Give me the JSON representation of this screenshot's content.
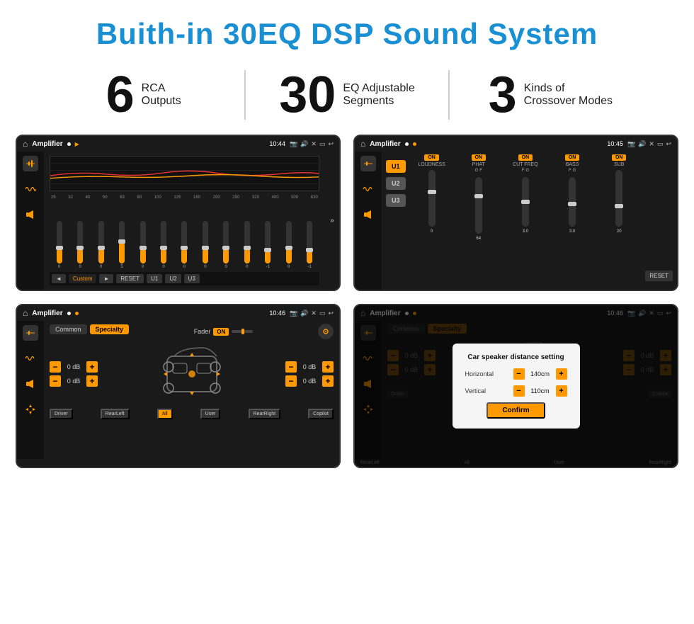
{
  "page": {
    "title": "Buith-in 30EQ DSP Sound System"
  },
  "stats": [
    {
      "number": "6",
      "text_line1": "RCA",
      "text_line2": "Outputs"
    },
    {
      "number": "30",
      "text_line1": "EQ Adjustable",
      "text_line2": "Segments"
    },
    {
      "number": "3",
      "text_line1": "Kinds of",
      "text_line2": "Crossover Modes"
    }
  ],
  "screens": {
    "screen1": {
      "title": "Amplifier",
      "time": "10:44",
      "preset": "Custom",
      "freq_labels": [
        "25",
        "32",
        "40",
        "50",
        "63",
        "80",
        "100",
        "125",
        "160",
        "200",
        "250",
        "320",
        "400",
        "500",
        "630"
      ],
      "values": [
        "0",
        "0",
        "0",
        "5",
        "0",
        "0",
        "0",
        "0",
        "0",
        "0",
        "-1",
        "0",
        "-1"
      ],
      "buttons": [
        "◄",
        "Custom",
        "►",
        "RESET",
        "U1",
        "U2",
        "U3"
      ]
    },
    "screen2": {
      "title": "Amplifier",
      "time": "10:45",
      "u_buttons": [
        "U1",
        "U2",
        "U3"
      ],
      "channels": [
        "LOUDNESS",
        "PHAT",
        "CUT FREQ",
        "BASS",
        "SUB"
      ],
      "channel_on": [
        true,
        true,
        true,
        true,
        true
      ]
    },
    "screen3": {
      "title": "Amplifier",
      "time": "10:46",
      "tabs": [
        "Common",
        "Specialty"
      ],
      "active_tab": "Specialty",
      "fader_label": "Fader",
      "fader_on": "ON",
      "db_values": [
        "0 dB",
        "0 dB",
        "0 dB",
        "0 dB"
      ],
      "bottom_buttons": [
        "Driver",
        "RearLeft",
        "All",
        "User",
        "RearRight",
        "Copilot"
      ]
    },
    "screen4": {
      "title": "Amplifier",
      "time": "10:46",
      "tabs": [
        "Common",
        "Specialty"
      ],
      "dialog": {
        "title": "Car speaker distance setting",
        "horizontal_label": "Horizontal",
        "horizontal_value": "140cm",
        "vertical_label": "Vertical",
        "vertical_value": "110cm",
        "confirm_label": "Confirm"
      },
      "db_values": [
        "0 dB",
        "0 dB"
      ],
      "bottom_buttons": [
        "Driver",
        "RearLeft",
        "All",
        "User",
        "RearRight",
        "Copilot"
      ]
    }
  }
}
